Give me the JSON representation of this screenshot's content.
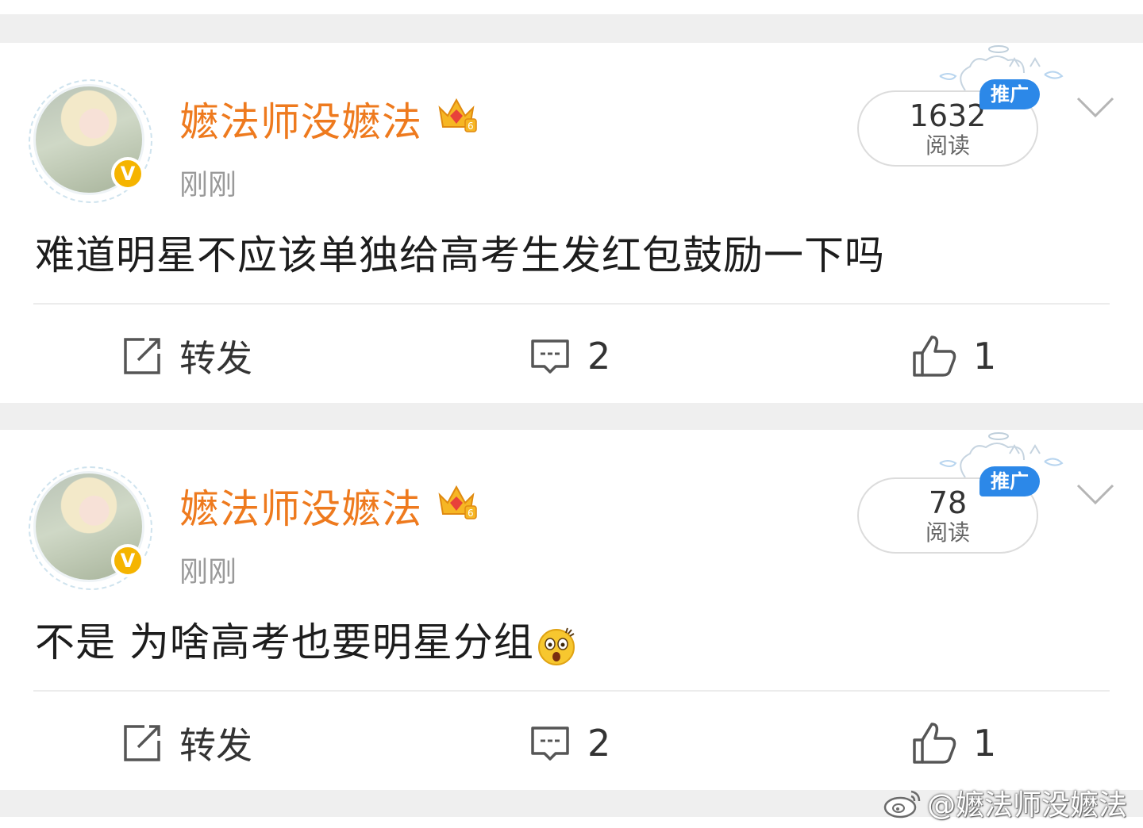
{
  "posts": [
    {
      "username": "嬷法师没嬷法",
      "time": "刚刚",
      "read_count": "1632",
      "read_label": "阅读",
      "promo_tag": "推广",
      "text": "难道明星不应该单独给高考生发红包鼓励一下吗",
      "actions": {
        "repost": "转发",
        "comments": "2",
        "likes": "1"
      }
    },
    {
      "username": "嬷法师没嬷法",
      "time": "刚刚",
      "read_count": "78",
      "read_label": "阅读",
      "promo_tag": "推广",
      "text": "不是 为啥高考也要明星分组",
      "emoji": "surprised-face",
      "actions": {
        "repost": "转发",
        "comments": "2",
        "likes": "1"
      }
    }
  ],
  "watermark": "@嬷法师没嬷法",
  "colors": {
    "username": "#ee7a1e",
    "promo": "#2c88e8",
    "badge": "#f5b400",
    "page_bg": "#efefef"
  }
}
